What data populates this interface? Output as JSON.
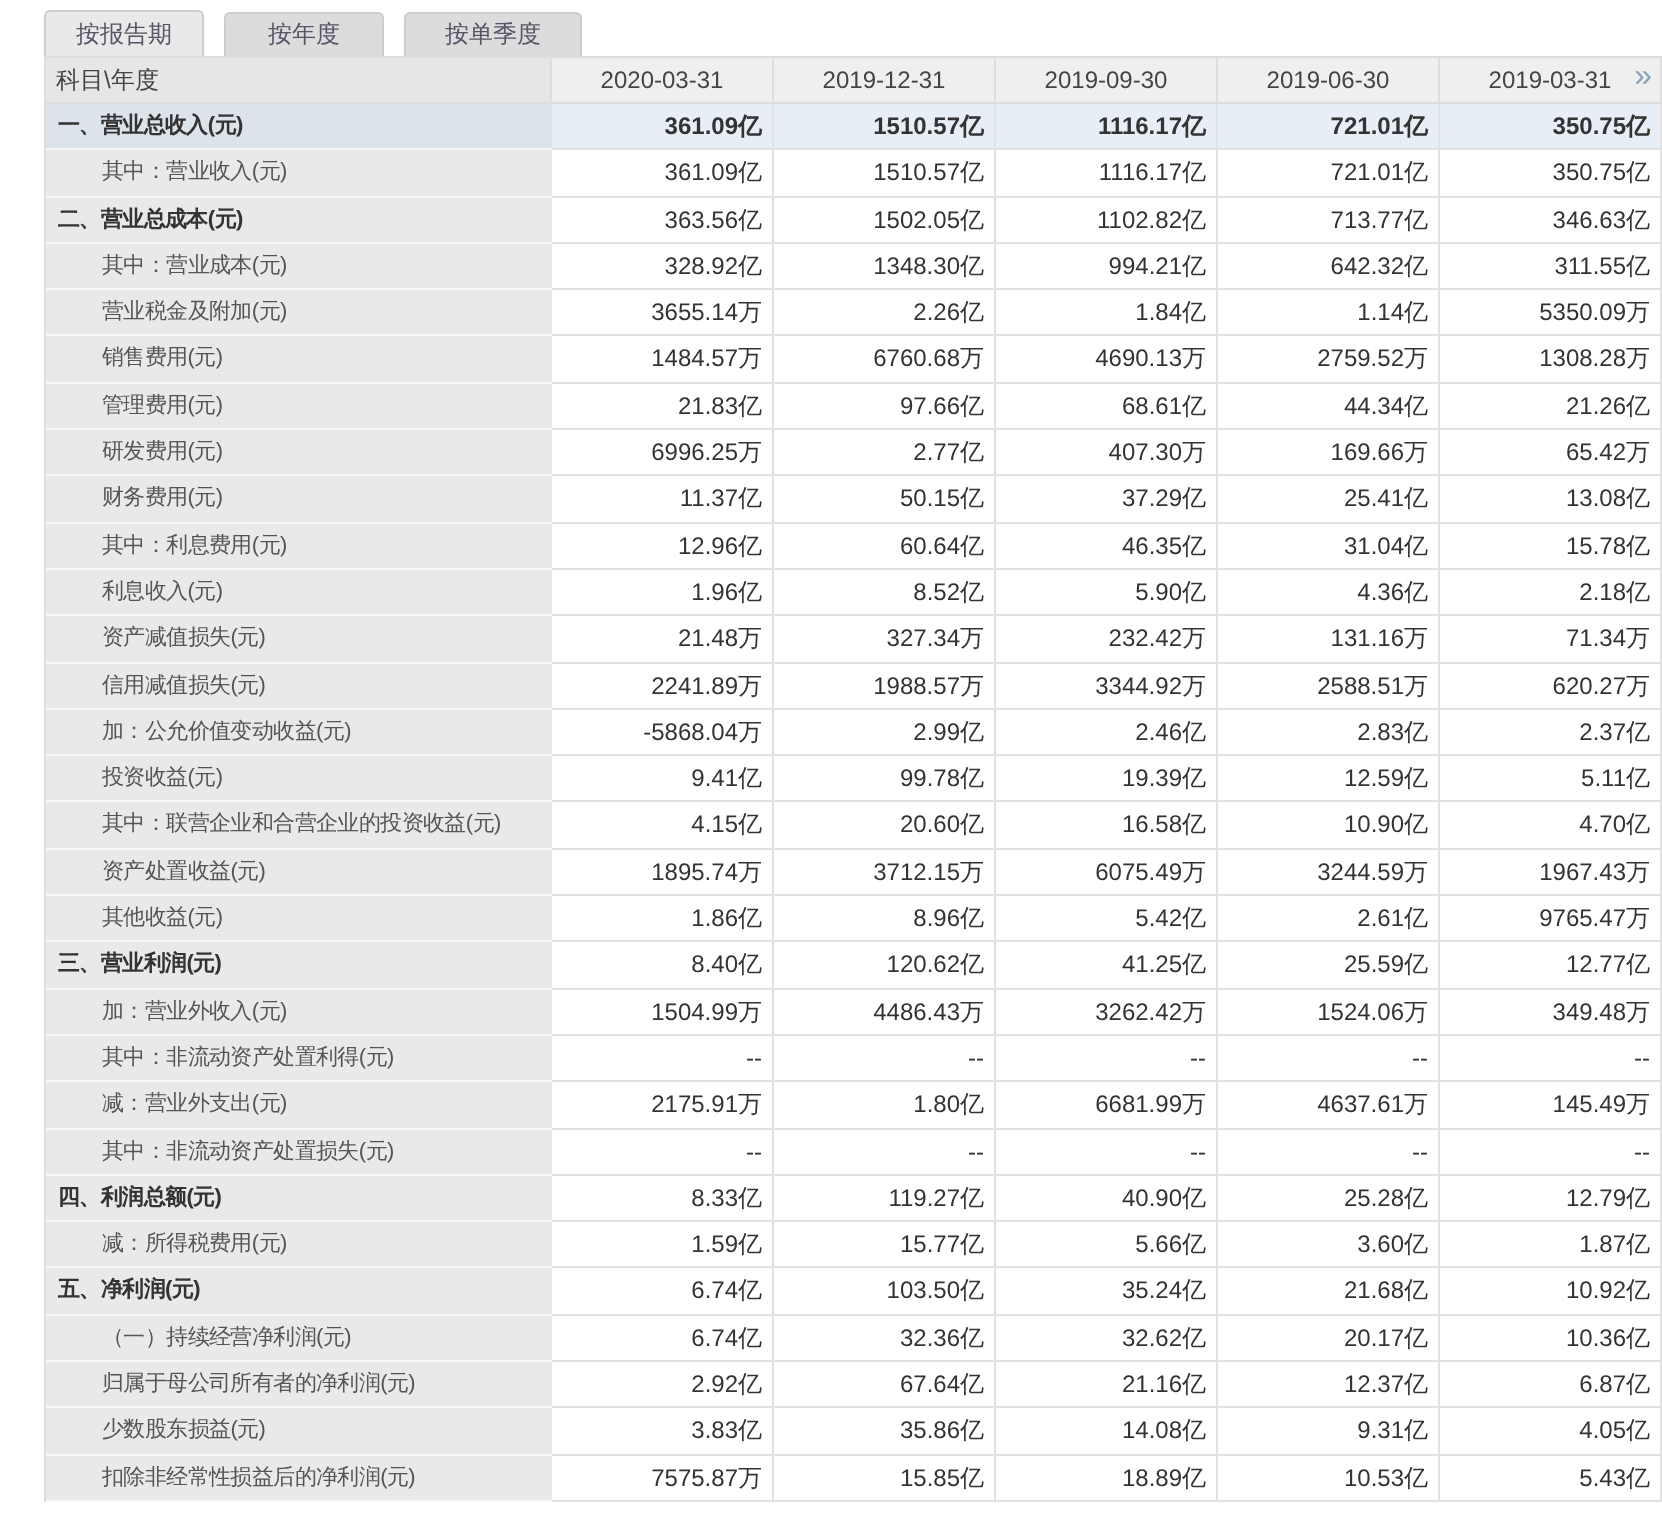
{
  "tabs": [
    {
      "label": "按报告期",
      "selected": true
    },
    {
      "label": "按年度",
      "selected": false
    },
    {
      "label": "按单季度",
      "selected": false
    }
  ],
  "table": {
    "columns": [
      "科目\\年度",
      "2020-03-31",
      "2019-12-31",
      "2019-09-30",
      "2019-06-30",
      "2019-03-31"
    ],
    "more_columns": "»",
    "rows": [
      {
        "kind": "section",
        "highlighted": true,
        "label": "一、营业总收入(元)",
        "values": [
          "361.09亿",
          "1510.57亿",
          "1116.17亿",
          "721.01亿",
          "350.75亿"
        ]
      },
      {
        "kind": "item",
        "highlighted": false,
        "label": "其中：营业收入(元)",
        "values": [
          "361.09亿",
          "1510.57亿",
          "1116.17亿",
          "721.01亿",
          "350.75亿"
        ]
      },
      {
        "kind": "section",
        "highlighted": false,
        "label": "二、营业总成本(元)",
        "values": [
          "363.56亿",
          "1502.05亿",
          "1102.82亿",
          "713.77亿",
          "346.63亿"
        ]
      },
      {
        "kind": "item",
        "highlighted": false,
        "label": "其中：营业成本(元)",
        "values": [
          "328.92亿",
          "1348.30亿",
          "994.21亿",
          "642.32亿",
          "311.55亿"
        ]
      },
      {
        "kind": "item",
        "highlighted": false,
        "label": "营业税金及附加(元)",
        "values": [
          "3655.14万",
          "2.26亿",
          "1.84亿",
          "1.14亿",
          "5350.09万"
        ]
      },
      {
        "kind": "item",
        "highlighted": false,
        "label": "销售费用(元)",
        "values": [
          "1484.57万",
          "6760.68万",
          "4690.13万",
          "2759.52万",
          "1308.28万"
        ]
      },
      {
        "kind": "item",
        "highlighted": false,
        "label": "管理费用(元)",
        "values": [
          "21.83亿",
          "97.66亿",
          "68.61亿",
          "44.34亿",
          "21.26亿"
        ]
      },
      {
        "kind": "item",
        "highlighted": false,
        "label": "研发费用(元)",
        "values": [
          "6996.25万",
          "2.77亿",
          "407.30万",
          "169.66万",
          "65.42万"
        ]
      },
      {
        "kind": "item",
        "highlighted": false,
        "label": "财务费用(元)",
        "values": [
          "11.37亿",
          "50.15亿",
          "37.29亿",
          "25.41亿",
          "13.08亿"
        ]
      },
      {
        "kind": "item",
        "highlighted": false,
        "label": "其中：利息费用(元)",
        "values": [
          "12.96亿",
          "60.64亿",
          "46.35亿",
          "31.04亿",
          "15.78亿"
        ]
      },
      {
        "kind": "item",
        "highlighted": false,
        "label": "利息收入(元)",
        "values": [
          "1.96亿",
          "8.52亿",
          "5.90亿",
          "4.36亿",
          "2.18亿"
        ]
      },
      {
        "kind": "item",
        "highlighted": false,
        "label": "资产减值损失(元)",
        "values": [
          "21.48万",
          "327.34万",
          "232.42万",
          "131.16万",
          "71.34万"
        ]
      },
      {
        "kind": "item",
        "highlighted": false,
        "label": "信用减值损失(元)",
        "values": [
          "2241.89万",
          "1988.57万",
          "3344.92万",
          "2588.51万",
          "620.27万"
        ]
      },
      {
        "kind": "item",
        "highlighted": false,
        "label": "加：公允价值变动收益(元)",
        "values": [
          "-5868.04万",
          "2.99亿",
          "2.46亿",
          "2.83亿",
          "2.37亿"
        ]
      },
      {
        "kind": "item",
        "highlighted": false,
        "label": "投资收益(元)",
        "values": [
          "9.41亿",
          "99.78亿",
          "19.39亿",
          "12.59亿",
          "5.11亿"
        ]
      },
      {
        "kind": "item",
        "highlighted": false,
        "label": "其中：联营企业和合营企业的投资收益(元)",
        "values": [
          "4.15亿",
          "20.60亿",
          "16.58亿",
          "10.90亿",
          "4.70亿"
        ]
      },
      {
        "kind": "item",
        "highlighted": false,
        "label": "资产处置收益(元)",
        "values": [
          "1895.74万",
          "3712.15万",
          "6075.49万",
          "3244.59万",
          "1967.43万"
        ]
      },
      {
        "kind": "item",
        "highlighted": false,
        "label": "其他收益(元)",
        "values": [
          "1.86亿",
          "8.96亿",
          "5.42亿",
          "2.61亿",
          "9765.47万"
        ]
      },
      {
        "kind": "section",
        "highlighted": false,
        "label": "三、营业利润(元)",
        "values": [
          "8.40亿",
          "120.62亿",
          "41.25亿",
          "25.59亿",
          "12.77亿"
        ]
      },
      {
        "kind": "item",
        "highlighted": false,
        "label": "加：营业外收入(元)",
        "values": [
          "1504.99万",
          "4486.43万",
          "3262.42万",
          "1524.06万",
          "349.48万"
        ]
      },
      {
        "kind": "item",
        "highlighted": false,
        "label": "其中：非流动资产处置利得(元)",
        "values": [
          "--",
          "--",
          "--",
          "--",
          "--"
        ]
      },
      {
        "kind": "item",
        "highlighted": false,
        "label": "减：营业外支出(元)",
        "values": [
          "2175.91万",
          "1.80亿",
          "6681.99万",
          "4637.61万",
          "145.49万"
        ]
      },
      {
        "kind": "item",
        "highlighted": false,
        "label": "其中：非流动资产处置损失(元)",
        "values": [
          "--",
          "--",
          "--",
          "--",
          "--"
        ]
      },
      {
        "kind": "section",
        "highlighted": false,
        "label": "四、利润总额(元)",
        "values": [
          "8.33亿",
          "119.27亿",
          "40.90亿",
          "25.28亿",
          "12.79亿"
        ]
      },
      {
        "kind": "item",
        "highlighted": false,
        "label": "减：所得税费用(元)",
        "values": [
          "1.59亿",
          "15.77亿",
          "5.66亿",
          "3.60亿",
          "1.87亿"
        ]
      },
      {
        "kind": "section",
        "highlighted": false,
        "label": "五、净利润(元)",
        "values": [
          "6.74亿",
          "103.50亿",
          "35.24亿",
          "21.68亿",
          "10.92亿"
        ]
      },
      {
        "kind": "item",
        "highlighted": false,
        "label": "（一）持续经营净利润(元)",
        "values": [
          "6.74亿",
          "32.36亿",
          "32.62亿",
          "20.17亿",
          "10.36亿"
        ]
      },
      {
        "kind": "item",
        "highlighted": false,
        "label": "归属于母公司所有者的净利润(元)",
        "values": [
          "2.92亿",
          "67.64亿",
          "21.16亿",
          "12.37亿",
          "6.87亿"
        ]
      },
      {
        "kind": "item",
        "highlighted": false,
        "label": "少数股东损益(元)",
        "values": [
          "3.83亿",
          "35.86亿",
          "14.08亿",
          "9.31亿",
          "4.05亿"
        ]
      },
      {
        "kind": "item",
        "highlighted": false,
        "label": "扣除非经常性损益后的净利润(元)",
        "values": [
          "7575.87万",
          "15.85亿",
          "18.89亿",
          "10.53亿",
          "5.43亿"
        ]
      }
    ]
  }
}
